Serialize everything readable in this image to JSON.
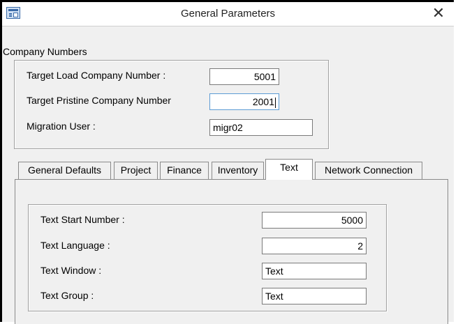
{
  "window": {
    "title": "General Parameters",
    "close_glyph": "✕",
    "app_icon": "form-icon"
  },
  "company_group": {
    "caption": "Company Numbers",
    "target_load_label": "Target Load Company Number :",
    "target_load_value": "5001",
    "target_pristine_label": "Target Pristine Company Number",
    "target_pristine_value": "2001",
    "migration_user_label": "Migration User :",
    "migration_user_value": "migr02"
  },
  "tabs": [
    {
      "label": "General Defaults",
      "active": false
    },
    {
      "label": "Project",
      "active": false
    },
    {
      "label": "Finance",
      "active": false
    },
    {
      "label": "Inventory",
      "active": false
    },
    {
      "label": "Text",
      "active": true
    },
    {
      "label": "Network Connection",
      "active": false
    }
  ],
  "text_tab": {
    "start_number_label": "Text Start Number :",
    "start_number_value": "5000",
    "language_label": "Text Language :",
    "language_value": "2",
    "window_label": "Text Window :",
    "window_value": "Text",
    "group_label": "Text Group :",
    "group_value": "Text"
  }
}
